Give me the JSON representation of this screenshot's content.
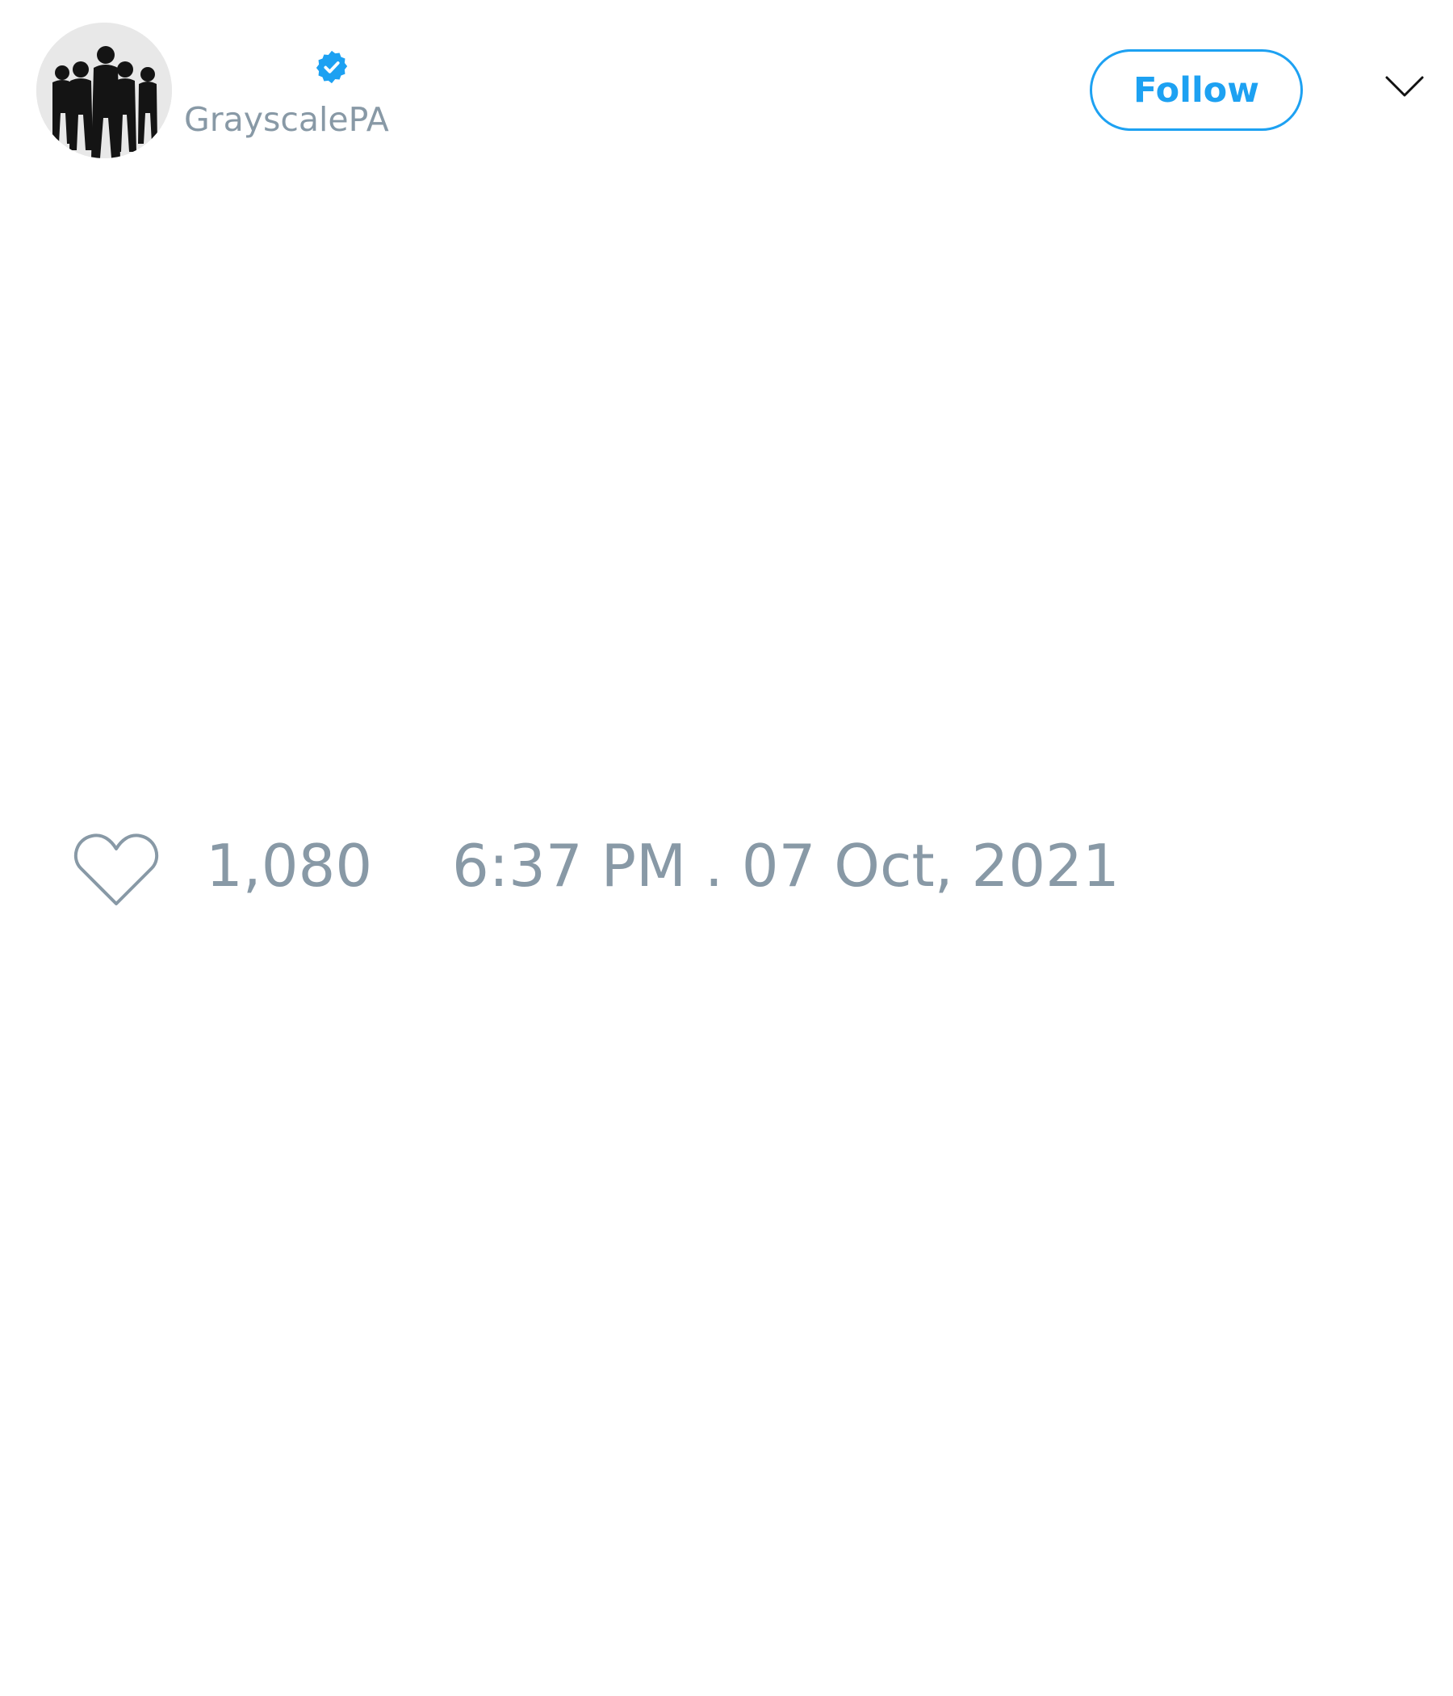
{
  "header": {
    "avatar_alt": "avatar",
    "display_name": "",
    "handle": "GrayscalePA",
    "follow_label": "Follow"
  },
  "tweet": {
    "text": "",
    "like_count": "1,080",
    "timestamp": "6:37 PM . 07 Oct, 2021"
  },
  "icons": {
    "verified": "verified-badge-icon",
    "menu": "chevron-down-icon",
    "like": "heart-outline-icon"
  },
  "colors": {
    "accent": "#1da1f2",
    "muted_text": "#8899a6",
    "background": "#ffffff"
  }
}
